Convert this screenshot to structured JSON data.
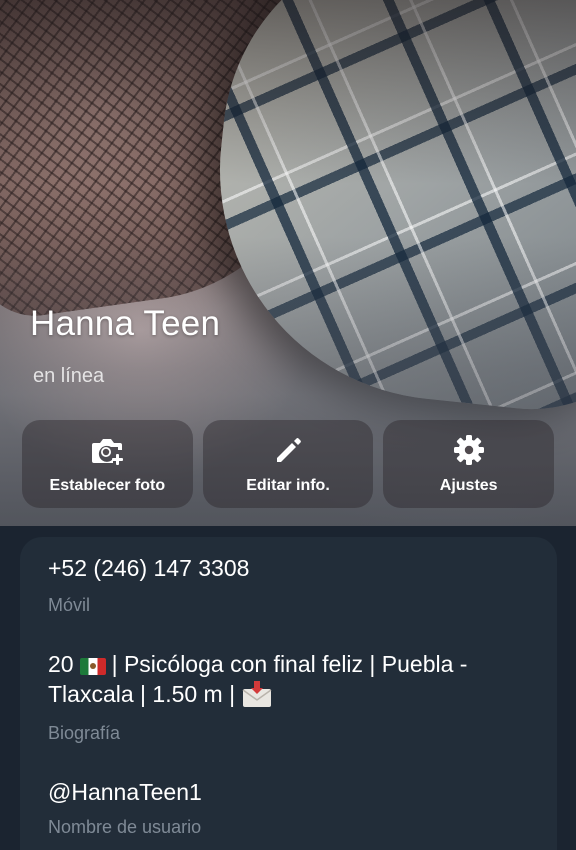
{
  "profile": {
    "name": "Hanna Teen",
    "status": "en línea"
  },
  "actions": [
    {
      "label": "Establecer foto",
      "icon": "add-photo-icon"
    },
    {
      "label": "Editar info.",
      "icon": "pencil-icon"
    },
    {
      "label": "Ajustes",
      "icon": "gear-icon"
    }
  ],
  "info": {
    "phone": {
      "value": "+52 (246) 147 3308",
      "caption": "Móvil"
    },
    "bio": {
      "part1": "20",
      "part2": "| Psicóloga con final feliz | Puebla -",
      "part3": "Tlaxcala | 1.50 m |",
      "emojis": [
        "mexico-flag-icon",
        "incoming-envelope-icon"
      ],
      "caption": "Biografía"
    },
    "username": {
      "value": "@HannaTeen1",
      "caption": "Nombre de usuario"
    }
  },
  "colors": {
    "background": "#1b2430",
    "card": "#222d39",
    "caption": "#7f8a96",
    "text": "#ffffff"
  }
}
